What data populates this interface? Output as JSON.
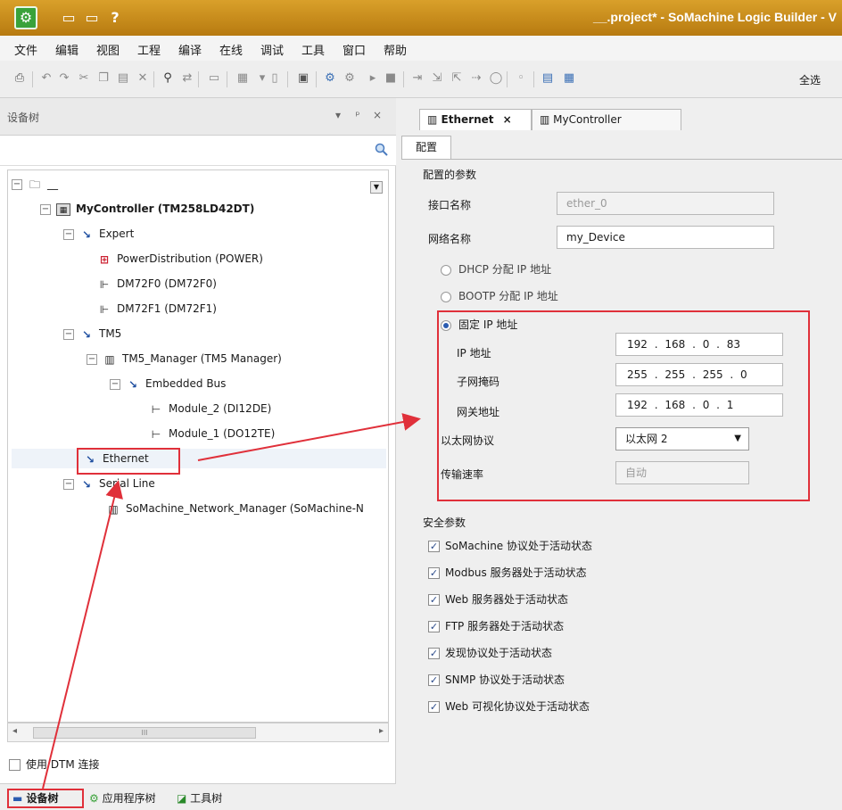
{
  "title_bar": {
    "text": "__.project* - SoMachine Logic Builder - V",
    "app_icon": "gear-icon",
    "quick_access": [
      "save-icon",
      "save-all-icon",
      "?"
    ]
  },
  "menu": [
    "文件",
    "编辑",
    "视图",
    "工程",
    "编译",
    "在线",
    "调试",
    "工具",
    "窗口",
    "帮助"
  ],
  "toolbar": {
    "select_all": "全选"
  },
  "left_panel": {
    "title": "设备树",
    "controls": [
      "▾",
      "ᵖ",
      "×"
    ],
    "tree": [
      {
        "label": "__",
        "level": 0
      },
      {
        "label": "MyController (TM258LD42DT)",
        "level": 1
      },
      {
        "label": "Expert",
        "level": 2
      },
      {
        "label": "PowerDistribution (POWER)",
        "level": 3
      },
      {
        "label": "DM72F0 (DM72F0)",
        "level": 3
      },
      {
        "label": "DM72F1 (DM72F1)",
        "level": 3
      },
      {
        "label": "TM5",
        "level": 2
      },
      {
        "label": "TM5_Manager (TM5 Manager)",
        "level": 3
      },
      {
        "label": "Embedded Bus",
        "level": 4
      },
      {
        "label": "Module_2 (DI12DE)",
        "level": 5
      },
      {
        "label": "Module_1 (DO12TE)",
        "level": 5
      },
      {
        "label": "Ethernet",
        "level": 2
      },
      {
        "label": "Serial Line",
        "level": 2
      },
      {
        "label": "SoMachine_Network_Manager (SoMachine-N",
        "level": 3
      }
    ],
    "scrollbar_thumb": "III",
    "dtm_label": "使用 DTM 连接",
    "bottom_tabs": [
      "设备树",
      "应用程序树",
      "工具树"
    ]
  },
  "right_panel": {
    "tabs": [
      {
        "label": "Ethernet",
        "close": "×",
        "active": true
      },
      {
        "label": "MyController",
        "active": false
      }
    ],
    "config_tab": "配置",
    "configured_params": {
      "title": "配置的参数",
      "interface_name_label": "接口名称",
      "interface_name_value": "ether_0",
      "network_name_label": "网络名称",
      "network_name_value": "my_Device",
      "dhcp_label": "DHCP 分配 IP 地址",
      "bootp_label": "BOOTP 分配 IP 地址",
      "fixed_ip_label": "固定 IP 地址",
      "ip_label": "IP 地址",
      "ip_value": "192 . 168 . 0 . 83",
      "subnet_label": "子网掩码",
      "subnet_value": "255 . 255 . 255 . 0",
      "gateway_label": "网关地址",
      "gateway_value": "192 . 168 . 0 . 1",
      "protocol_label": "以太网协议",
      "protocol_value": "以太网 2",
      "speed_label": "传输速率",
      "speed_value": "自动"
    },
    "security": {
      "title": "安全参数",
      "items": [
        "SoMachine 协议处于活动状态",
        "Modbus 服务器处于活动状态",
        "Web 服务器处于活动状态",
        "FTP 服务器处于活动状态",
        "发现协议处于活动状态",
        "SNMP 协议处于活动状态",
        "Web 可视化协议处于活动状态"
      ]
    }
  },
  "colors": {
    "title_bar": "#c98d1a",
    "highlight": "#e0303a",
    "panel_bg": "#efefef"
  }
}
